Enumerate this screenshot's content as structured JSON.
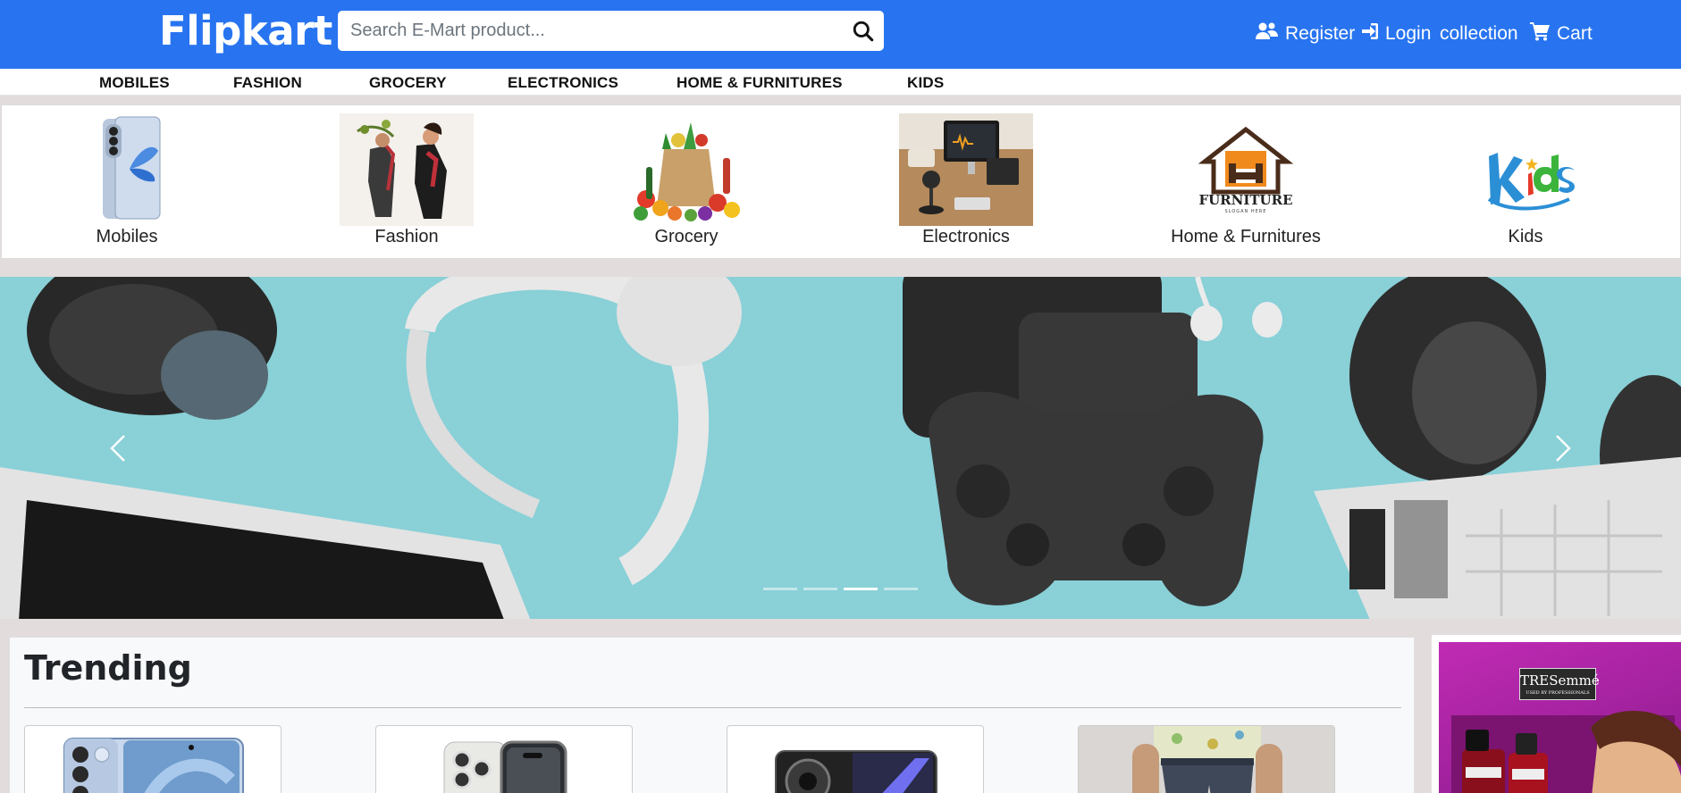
{
  "header": {
    "brand": "Flipkart",
    "search_placeholder": "Search E-Mart product...",
    "register_label": "Register",
    "login_label": "Login",
    "collection_label": "collection",
    "cart_label": "Cart"
  },
  "category_nav": [
    "MOBILES",
    "FASHION",
    "GROCERY",
    "ELECTRONICS",
    "HOME & FURNITURES",
    "KIDS"
  ],
  "category_tiles": [
    "Mobiles",
    "Fashion",
    "Grocery",
    "Electronics",
    "Home & Furnitures",
    "Kids"
  ],
  "tile_image_text": {
    "furniture_logo": "FURNITURE",
    "furniture_slogan": "SLOGAN HERE",
    "kids_logo": "Kids"
  },
  "carousel": {
    "slide_count": 4,
    "active_index": 2
  },
  "trending": {
    "title": "Trending"
  },
  "ad": {
    "brand": "TRESemmé",
    "tagline": "USED BY PROFESSIONALS"
  },
  "colors": {
    "header_bg": "#2874f0",
    "page_bg": "#e2dcdc"
  }
}
